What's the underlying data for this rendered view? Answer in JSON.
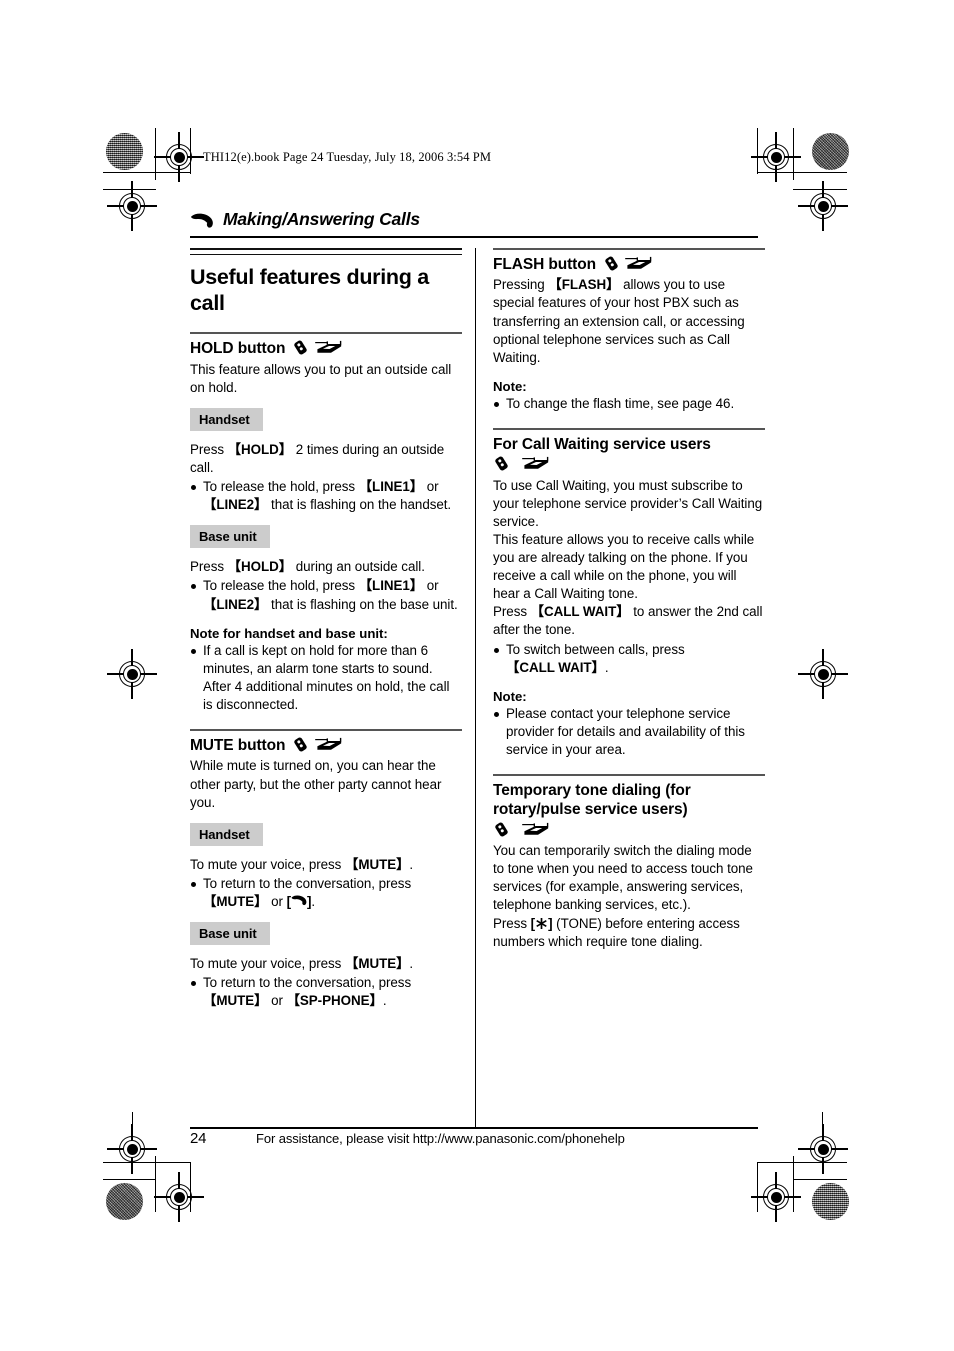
{
  "print_marks": {
    "note": "offset printing registration targets and halftone density patches"
  },
  "page_header_path": "THI12(e).book  Page 24  Tuesday, July 18, 2006  3:54 PM",
  "chapter": {
    "icon": "telephone-handset-icon",
    "title": "Making/Answering Calls"
  },
  "left_column": {
    "section_title": "Useful features during a call",
    "hold": {
      "heading": "HOLD button",
      "heading_icons": [
        "cordless-handset-icon",
        "base-unit-icon"
      ],
      "intro": "This feature allows you to put an outside call on hold.",
      "handset_badge": "Handset",
      "handset_instruction_pre": "Press ",
      "handset_instruction_key": "{HOLD}",
      "handset_instruction_post": " 2 times during an outside call.",
      "handset_bullets": [
        {
          "pre": "To release the hold, press ",
          "key1": "{LINE1}",
          "mid": " or ",
          "key2": "{LINE2}",
          "post": " that is flashing on the handset."
        }
      ],
      "base_badge": "Base unit",
      "base_instruction_pre": "Press ",
      "base_instruction_key": "{HOLD}",
      "base_instruction_post": " during an outside call.",
      "base_bullets": [
        {
          "pre": "To release the hold, press ",
          "key1": "{LINE1}",
          "mid": " or ",
          "key2": "{LINE2}",
          "post": " that is flashing on the base unit."
        }
      ],
      "note_heading": "Note for handset and base unit:",
      "note_bullets": [
        "If a call is kept on hold for more than 6 minutes, an alarm tone starts to sound. After 4 additional minutes on hold, the call is disconnected."
      ]
    },
    "mute": {
      "heading": "MUTE button",
      "heading_icons": [
        "cordless-handset-icon",
        "base-unit-icon"
      ],
      "intro": "While mute is turned on, you can hear the other party, but the other party cannot hear you.",
      "handset_badge": "Handset",
      "handset_instruction_pre": "To mute your voice, press ",
      "handset_instruction_key": "{MUTE}",
      "handset_instruction_post": ".",
      "handset_bullet_pre": "To return to the conversation, press ",
      "handset_bullet_key1": "{MUTE}",
      "handset_bullet_mid": " or ",
      "handset_bullet_key2_icon": "talk-key-icon",
      "handset_bullet_post": ".",
      "base_badge": "Base unit",
      "base_instruction_pre": "To mute your voice, press ",
      "base_instruction_key": "{MUTE}",
      "base_instruction_post": ".",
      "base_bullet_pre": "To return to the conversation, press ",
      "base_bullet_key1": "{MUTE}",
      "base_bullet_mid": " or ",
      "base_bullet_key2": "{SP-PHONE}",
      "base_bullet_post": "."
    }
  },
  "right_column": {
    "flash": {
      "heading": "FLASH button",
      "heading_icons": [
        "cordless-handset-icon",
        "base-unit-icon"
      ],
      "body_pre": "Pressing ",
      "body_key": "{FLASH}",
      "body_post": " allows you to use special features of your host PBX such as transferring an extension call, or accessing optional telephone services such as Call Waiting.",
      "note_heading": "Note:",
      "note_bullets": [
        "To change the flash time, see page 46."
      ]
    },
    "call_waiting": {
      "heading": "For Call Waiting service users",
      "heading_icons": [
        "cordless-handset-icon",
        "base-unit-icon"
      ],
      "para1": "To use Call Waiting, you must subscribe to your telephone service provider’s Call Waiting service.",
      "para2": "This feature allows you to receive calls while you are already talking on the phone. If you receive a call while on the phone, you will hear a Call Waiting tone.",
      "para3_pre": "Press ",
      "para3_key": "{CALL WAIT}",
      "para3_post": " to answer the 2nd call after the tone.",
      "bullet_pre": "To switch between calls, press ",
      "bullet_key": "{CALL WAIT}",
      "bullet_post": ".",
      "note_heading": "Note:",
      "note_bullets": [
        "Please contact your telephone service provider for details and availability of this service in your area."
      ]
    },
    "tone_dialing": {
      "heading": "Temporary tone dialing (for rotary/pulse service users)",
      "heading_icons": [
        "cordless-handset-icon",
        "base-unit-icon"
      ],
      "para1": "You can temporarily switch the dialing mode to tone when you need to access touch tone services (for example, answering services, telephone banking services, etc.).",
      "para2_pre": "Press ",
      "para2_key_icon": "asterisk-tone-key-icon",
      "para2_post": " (TONE) before entering access numbers which require tone dialing."
    }
  },
  "footer": {
    "page_number": "24",
    "assistance_text": "For assistance, please visit http://www.panasonic.com/phonehelp"
  }
}
